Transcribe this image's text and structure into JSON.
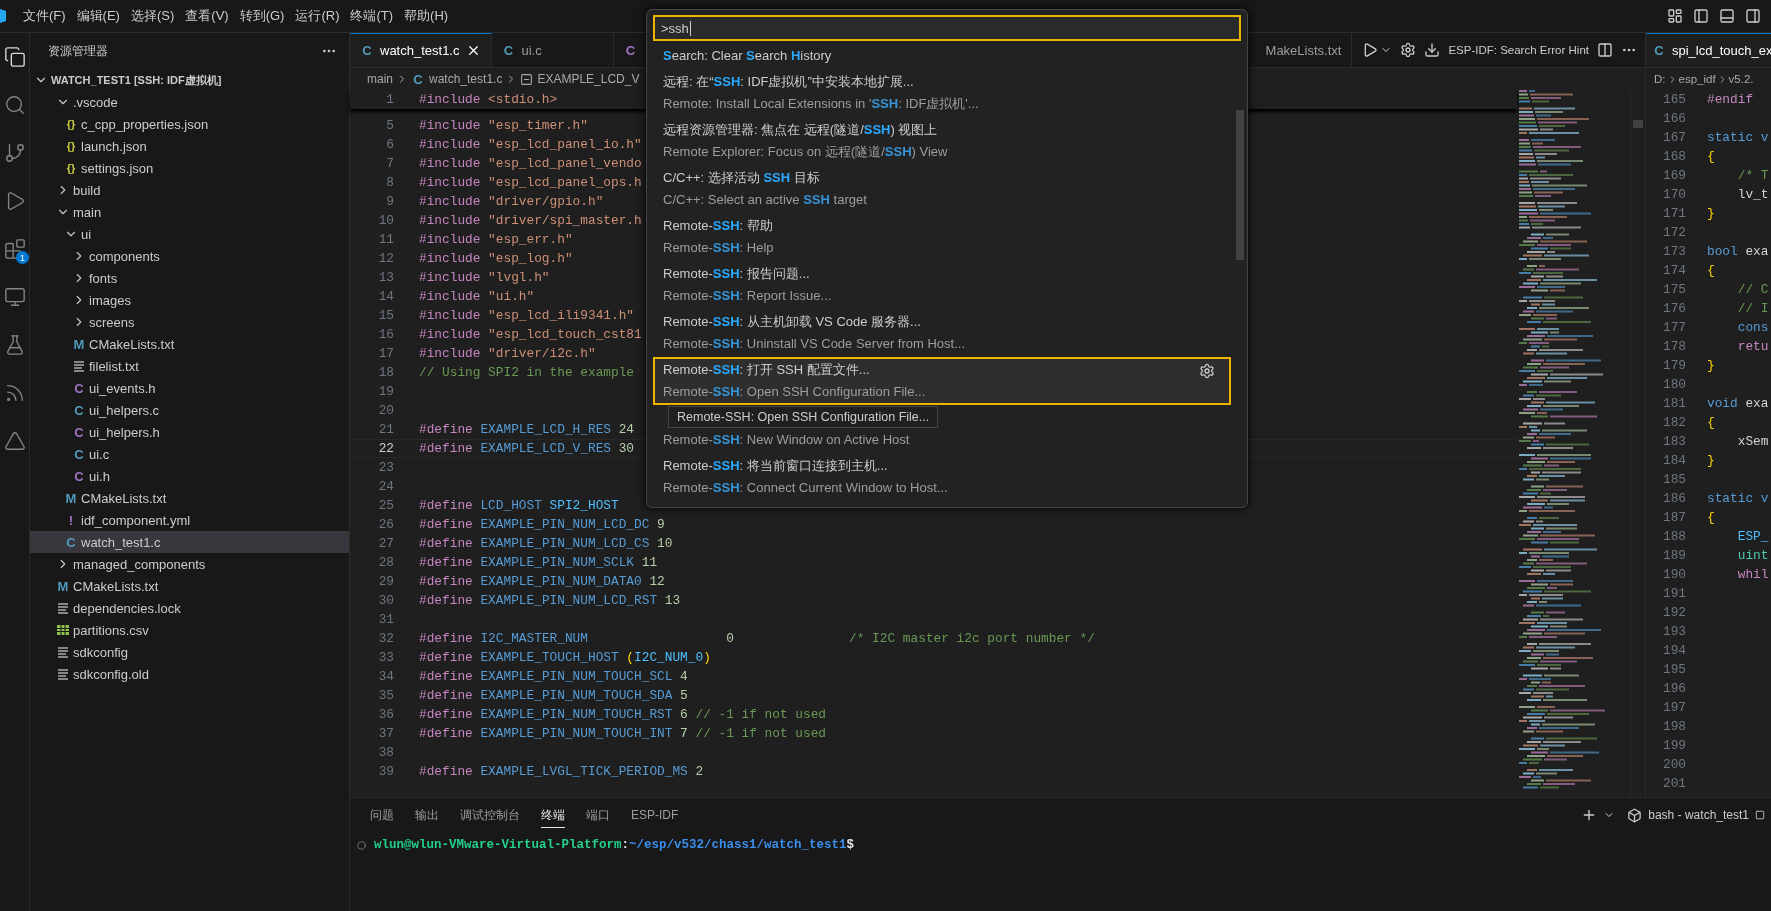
{
  "menubar": {
    "items": [
      "文件(F)",
      "编辑(E)",
      "选择(S)",
      "查看(V)",
      "转到(G)",
      "运行(R)",
      "终端(T)",
      "帮助(H)"
    ]
  },
  "activity_bar": {
    "items": [
      {
        "kind": "explorer",
        "selected": true
      },
      {
        "kind": "search",
        "selected": false
      },
      {
        "kind": "source_control",
        "selected": false
      },
      {
        "kind": "run",
        "selected": false
      },
      {
        "kind": "extensions",
        "selected": false,
        "badge": "1"
      },
      {
        "kind": "remote",
        "selected": false
      },
      {
        "kind": "testing",
        "selected": false
      },
      {
        "kind": "espidf",
        "selected": false
      },
      {
        "kind": "other",
        "selected": false
      }
    ]
  },
  "explorer": {
    "title": "资源管理器",
    "root": {
      "label": "WATCH_TEST1 [SSH: IDF虚拟机]",
      "expanded": true
    },
    "items": [
      {
        "name": ".vscode",
        "kind": "folder",
        "expanded": true,
        "selected": false,
        "children": [
          {
            "name": "c_cpp_properties.json",
            "kind": "json",
            "glyph": "{}",
            "selected": false
          },
          {
            "name": "launch.json",
            "kind": "json",
            "glyph": "{}",
            "selected": false
          },
          {
            "name": "settings.json",
            "kind": "json",
            "glyph": "{}",
            "selected": false
          }
        ]
      },
      {
        "name": "build",
        "kind": "folder",
        "expanded": false,
        "selected": false
      },
      {
        "name": "main",
        "kind": "folder",
        "expanded": true,
        "selected": false,
        "children": [
          {
            "name": "ui",
            "kind": "folder",
            "expanded": true,
            "selected": false,
            "children": [
              {
                "name": "components",
                "kind": "folder",
                "expanded": false,
                "selected": false
              },
              {
                "name": "fonts",
                "kind": "folder",
                "expanded": false,
                "selected": false
              },
              {
                "name": "images",
                "kind": "folder",
                "expanded": false,
                "selected": false
              },
              {
                "name": "screens",
                "kind": "folder",
                "expanded": false,
                "selected": false
              },
              {
                "name": "CMakeLists.txt",
                "kind": "cmake",
                "glyph": "M",
                "selected": false
              },
              {
                "name": "filelist.txt",
                "kind": "text",
                "selected": false
              },
              {
                "name": "ui_events.h",
                "kind": "h",
                "glyph": "C",
                "selected": false
              },
              {
                "name": "ui_helpers.c",
                "kind": "c",
                "glyph": "C",
                "selected": false
              },
              {
                "name": "ui_helpers.h",
                "kind": "h",
                "glyph": "C",
                "selected": false
              },
              {
                "name": "ui.c",
                "kind": "c",
                "glyph": "C",
                "selected": false
              },
              {
                "name": "ui.h",
                "kind": "h",
                "glyph": "C",
                "selected": false
              }
            ]
          },
          {
            "name": "CMakeLists.txt",
            "kind": "cmake",
            "glyph": "M",
            "selected": false
          },
          {
            "name": "idf_component.yml",
            "kind": "yml",
            "glyph": "!",
            "selected": false
          },
          {
            "name": "watch_test1.c",
            "kind": "c",
            "glyph": "C",
            "selected": true
          }
        ]
      },
      {
        "name": "managed_components",
        "kind": "folder",
        "expanded": false,
        "selected": false
      },
      {
        "name": "CMakeLists.txt",
        "kind": "cmake",
        "glyph": "M",
        "selected": false
      },
      {
        "name": "dependencies.lock",
        "kind": "text",
        "selected": false
      },
      {
        "name": "partitions.csv",
        "kind": "csv",
        "selected": false
      },
      {
        "name": "sdkconfig",
        "kind": "text",
        "selected": false
      },
      {
        "name": "sdkconfig.old",
        "kind": "text",
        "selected": false
      }
    ]
  },
  "editor": {
    "tabs": [
      {
        "label": "watch_test1.c",
        "kind": "c",
        "glyph": "C",
        "selected": true
      },
      {
        "label": "ui.c",
        "kind": "c",
        "glyph": "C",
        "selected": false
      },
      {
        "kind": "h",
        "glyph": "C",
        "selected": false
      },
      {
        "label": "MakeLists.txt",
        "selected": false
      }
    ],
    "hint_button": "ESP-IDF: Search Error Hint",
    "breadcrumb": [
      {
        "label": "main",
        "kind": "folder"
      },
      {
        "label": "watch_test1.c",
        "kind": "c",
        "glyph": "C"
      },
      {
        "label": "EXAMPLE_LCD_V",
        "kind": "symbol"
      }
    ],
    "sticky_line": {
      "number": "1",
      "current": false,
      "tokens": [
        {
          "kind": "directive",
          "text": "#include"
        },
        {
          "kind": "string",
          "text": " <stdio.h>"
        }
      ]
    },
    "lines": [
      {
        "number": "5",
        "current": false,
        "tokens": [
          {
            "kind": "directive",
            "text": "#include"
          },
          {
            "kind": "string",
            "text": " \"esp_timer.h\""
          }
        ]
      },
      {
        "number": "6",
        "current": false,
        "tokens": [
          {
            "kind": "directive",
            "text": "#include"
          },
          {
            "kind": "string",
            "text": " \"esp_lcd_panel_io.h\""
          }
        ]
      },
      {
        "number": "7",
        "current": false,
        "tokens": [
          {
            "kind": "directive",
            "text": "#include"
          },
          {
            "kind": "string",
            "text": " \"esp_lcd_panel_vendo"
          }
        ]
      },
      {
        "number": "8",
        "current": false,
        "tokens": [
          {
            "kind": "directive",
            "text": "#include"
          },
          {
            "kind": "string",
            "text": " \"esp_lcd_panel_ops.h"
          }
        ]
      },
      {
        "number": "9",
        "current": false,
        "tokens": [
          {
            "kind": "directive",
            "text": "#include"
          },
          {
            "kind": "string",
            "text": " \"driver/gpio.h\""
          }
        ]
      },
      {
        "number": "10",
        "current": false,
        "tokens": [
          {
            "kind": "directive",
            "text": "#include"
          },
          {
            "kind": "string",
            "text": " \"driver/spi_master.h"
          }
        ]
      },
      {
        "number": "11",
        "current": false,
        "tokens": [
          {
            "kind": "directive",
            "text": "#include"
          },
          {
            "kind": "string",
            "text": " \"esp_err.h\""
          }
        ]
      },
      {
        "number": "12",
        "current": false,
        "tokens": [
          {
            "kind": "directive",
            "text": "#include"
          },
          {
            "kind": "string",
            "text": " \"esp_log.h\""
          }
        ]
      },
      {
        "number": "13",
        "current": false,
        "tokens": [
          {
            "kind": "directive",
            "text": "#include"
          },
          {
            "kind": "string",
            "text": " \"lvgl.h\""
          }
        ]
      },
      {
        "number": "14",
        "current": false,
        "tokens": [
          {
            "kind": "directive",
            "text": "#include"
          },
          {
            "kind": "string",
            "text": " \"ui.h\""
          }
        ]
      },
      {
        "number": "15",
        "current": false,
        "tokens": [
          {
            "kind": "directive",
            "text": "#include"
          },
          {
            "kind": "string",
            "text": " \"esp_lcd_ili9341.h\""
          }
        ]
      },
      {
        "number": "16",
        "current": false,
        "tokens": [
          {
            "kind": "directive",
            "text": "#include"
          },
          {
            "kind": "string",
            "text": " \"esp_lcd_touch_cst81"
          }
        ]
      },
      {
        "number": "17",
        "current": false,
        "tokens": [
          {
            "kind": "directive",
            "text": "#include"
          },
          {
            "kind": "string",
            "text": " \"driver/i2c.h\""
          }
        ]
      },
      {
        "number": "18",
        "current": false,
        "tokens": [
          {
            "kind": "comment",
            "text": "// Using SPI2 in the example"
          }
        ]
      },
      {
        "number": "19",
        "current": false
      },
      {
        "number": "20",
        "current": false
      },
      {
        "number": "21",
        "current": false,
        "tokens": [
          {
            "kind": "directive",
            "text": "#define"
          },
          {
            "kind": "macro",
            "text": " EXAMPLE_LCD_H_RES"
          },
          {
            "kind": "number",
            "text": " 24"
          }
        ]
      },
      {
        "number": "22",
        "current": true,
        "tokens": [
          {
            "kind": "directive",
            "text": "#define"
          },
          {
            "kind": "macro",
            "text": " EXAMPLE_LCD_V_RES"
          },
          {
            "kind": "number",
            "text": " 30"
          }
        ]
      },
      {
        "number": "23",
        "current": false
      },
      {
        "number": "24",
        "current": false
      },
      {
        "number": "25",
        "current": false,
        "tokens": [
          {
            "kind": "directive",
            "text": "#define"
          },
          {
            "kind": "macro",
            "text": " LCD_HOST"
          },
          {
            "kind": "constant",
            "text": " SPI2_HOST"
          }
        ]
      },
      {
        "number": "26",
        "current": false,
        "tokens": [
          {
            "kind": "directive",
            "text": "#define"
          },
          {
            "kind": "macro",
            "text": " EXAMPLE_PIN_NUM_LCD_DC"
          },
          {
            "kind": "number",
            "text": " 9"
          }
        ]
      },
      {
        "number": "27",
        "current": false,
        "tokens": [
          {
            "kind": "directive",
            "text": "#define"
          },
          {
            "kind": "macro",
            "text": " EXAMPLE_PIN_NUM_LCD_CS"
          },
          {
            "kind": "number",
            "text": " 10"
          }
        ]
      },
      {
        "number": "28",
        "current": false,
        "tokens": [
          {
            "kind": "directive",
            "text": "#define"
          },
          {
            "kind": "macro",
            "text": " EXAMPLE_PIN_NUM_SCLK"
          },
          {
            "kind": "number",
            "text": " 11"
          }
        ]
      },
      {
        "number": "29",
        "current": false,
        "tokens": [
          {
            "kind": "directive",
            "text": "#define"
          },
          {
            "kind": "macro",
            "text": " EXAMPLE_PIN_NUM_DATA0"
          },
          {
            "kind": "number",
            "text": " 12"
          }
        ]
      },
      {
        "number": "30",
        "current": false,
        "tokens": [
          {
            "kind": "directive",
            "text": "#define"
          },
          {
            "kind": "macro",
            "text": " EXAMPLE_PIN_NUM_LCD_RST"
          },
          {
            "kind": "number",
            "text": " 13"
          }
        ]
      },
      {
        "number": "31",
        "current": false
      },
      {
        "number": "32",
        "current": false,
        "tokens": [
          {
            "kind": "directive",
            "text": "#define"
          },
          {
            "kind": "macro",
            "text": " I2C_MASTER_NUM"
          },
          {
            "kind": "number",
            "text": "                  0"
          },
          {
            "kind": "comment",
            "text": "               /* I2C master i2c port number */"
          }
        ]
      },
      {
        "number": "33",
        "current": false,
        "tokens": [
          {
            "kind": "directive",
            "text": "#define"
          },
          {
            "kind": "macro",
            "text": " EXAMPLE_TOUCH_HOST"
          },
          {
            "kind": "bracket",
            "text": " ("
          },
          {
            "kind": "constant",
            "text": "I2C_NUM_0"
          },
          {
            "kind": "bracket",
            "text": ")"
          }
        ]
      },
      {
        "number": "34",
        "current": false,
        "tokens": [
          {
            "kind": "directive",
            "text": "#define"
          },
          {
            "kind": "macro",
            "text": " EXAMPLE_PIN_NUM_TOUCH_SCL"
          },
          {
            "kind": "number",
            "text": " 4"
          }
        ]
      },
      {
        "number": "35",
        "current": false,
        "tokens": [
          {
            "kind": "directive",
            "text": "#define"
          },
          {
            "kind": "macro",
            "text": " EXAMPLE_PIN_NUM_TOUCH_SDA"
          },
          {
            "kind": "number",
            "text": " 5"
          }
        ]
      },
      {
        "number": "36",
        "current": false,
        "tokens": [
          {
            "kind": "directive",
            "text": "#define"
          },
          {
            "kind": "macro",
            "text": " EXAMPLE_PIN_NUM_TOUCH_RST"
          },
          {
            "kind": "number",
            "text": " 6"
          },
          {
            "kind": "comment",
            "text": " // -1 if not used"
          }
        ]
      },
      {
        "number": "37",
        "current": false,
        "tokens": [
          {
            "kind": "directive",
            "text": "#define"
          },
          {
            "kind": "macro",
            "text": " EXAMPLE_PIN_NUM_TOUCH_INT"
          },
          {
            "kind": "number",
            "text": " 7"
          },
          {
            "kind": "comment",
            "text": " // -1 if not used"
          }
        ]
      },
      {
        "number": "38",
        "current": false
      },
      {
        "number": "39",
        "current": false,
        "tokens": [
          {
            "kind": "directive",
            "text": "#define"
          },
          {
            "kind": "macro",
            "text": " EXAMPLE_LVGL_TICK_PERIOD_MS"
          },
          {
            "kind": "number",
            "text": " 2"
          }
        ]
      }
    ]
  },
  "secondary_editor": {
    "tab": {
      "label": "spi_lcd_touch_ex",
      "kind": "c",
      "glyph": "C",
      "selected": true
    },
    "breadcrumb": [
      {
        "label": "D:"
      },
      {
        "label": "esp_idf"
      },
      {
        "label": "v5.2."
      }
    ],
    "lines": [
      {
        "number": "165",
        "tokens": [
          {
            "kind": "directive",
            "text": "#endif"
          }
        ]
      },
      {
        "number": "166"
      },
      {
        "number": "167",
        "tokens": [
          {
            "kind": "keyword",
            "text": "static v"
          }
        ]
      },
      {
        "number": "168",
        "tokens": [
          {
            "kind": "bracket",
            "text": "{"
          }
        ]
      },
      {
        "number": "169",
        "tokens": [
          {
            "kind": "comment",
            "text": "    /* T"
          }
        ]
      },
      {
        "number": "170",
        "tokens": [
          {
            "kind": "plain",
            "text": "    lv_t"
          }
        ]
      },
      {
        "number": "171",
        "tokens": [
          {
            "kind": "bracket",
            "text": "}"
          }
        ]
      },
      {
        "number": "172"
      },
      {
        "number": "173",
        "tokens": [
          {
            "kind": "keyword",
            "text": "bool"
          },
          {
            "kind": "plain",
            "text": " exa"
          }
        ]
      },
      {
        "number": "174",
        "tokens": [
          {
            "kind": "bracket",
            "text": "{"
          }
        ]
      },
      {
        "number": "175",
        "tokens": [
          {
            "kind": "comment",
            "text": "    // C"
          }
        ]
      },
      {
        "number": "176",
        "tokens": [
          {
            "kind": "comment",
            "text": "    // I"
          }
        ]
      },
      {
        "number": "177",
        "tokens": [
          {
            "kind": "keyword",
            "text": "    cons"
          }
        ]
      },
      {
        "number": "178",
        "tokens": [
          {
            "kind": "control",
            "text": "    retu"
          }
        ]
      },
      {
        "number": "179",
        "tokens": [
          {
            "kind": "bracket",
            "text": "}"
          }
        ]
      },
      {
        "number": "180"
      },
      {
        "number": "181",
        "tokens": [
          {
            "kind": "keyword",
            "text": "void"
          },
          {
            "kind": "plain",
            "text": " exa"
          }
        ]
      },
      {
        "number": "182",
        "tokens": [
          {
            "kind": "bracket",
            "text": "{"
          }
        ]
      },
      {
        "number": "183",
        "tokens": [
          {
            "kind": "plain",
            "text": "    xSem"
          }
        ]
      },
      {
        "number": "184",
        "tokens": [
          {
            "kind": "bracket",
            "text": "}"
          }
        ]
      },
      {
        "number": "185"
      },
      {
        "number": "186",
        "tokens": [
          {
            "kind": "keyword",
            "text": "static v"
          }
        ]
      },
      {
        "number": "187",
        "tokens": [
          {
            "kind": "bracket",
            "text": "{"
          }
        ]
      },
      {
        "number": "188",
        "tokens": [
          {
            "kind": "constant",
            "text": "    ESP_"
          }
        ]
      },
      {
        "number": "189",
        "tokens": [
          {
            "kind": "type",
            "text": "    uint"
          }
        ]
      },
      {
        "number": "190",
        "tokens": [
          {
            "kind": "control",
            "text": "    whil"
          }
        ]
      },
      {
        "number": "191"
      },
      {
        "number": "192"
      },
      {
        "number": "193"
      },
      {
        "number": "194"
      },
      {
        "number": "195"
      },
      {
        "number": "196"
      },
      {
        "number": "197"
      },
      {
        "number": "198"
      },
      {
        "number": "199"
      },
      {
        "number": "200"
      },
      {
        "number": "201"
      }
    ]
  },
  "command_palette": {
    "query": ">ssh",
    "items": [
      {
        "title": "**S**earch: Clear **S**earch **H**istory",
        "selected": false
      },
      {
        "title": "远程: 在“**SSH**: IDF虚拟机”中安装本地扩展...",
        "subtitle": "Remote: Install Local Extensions in '**SSH**: IDF虚拟机'...",
        "selected": false
      },
      {
        "title": "远程资源管理器: 焦点在 远程(隧道/**SSH**) 视图上",
        "subtitle": "Remote Explorer: Focus on 远程(隧道/**SSH**) View",
        "selected": false
      },
      {
        "title": "C/C++: 选择活动 **SSH** 目标",
        "subtitle": "C/C++: Select an active **SSH** target",
        "selected": false
      },
      {
        "title": "Remote-**SSH**: 帮助",
        "subtitle": "Remote-**SSH**: Help",
        "selected": false
      },
      {
        "title": "Remote-**SSH**: 报告问题...",
        "subtitle": "Remote-**SSH**: Report Issue...",
        "selected": false
      },
      {
        "title": "Remote-**SSH**: 从主机卸载 VS Code 服务器...",
        "subtitle": "Remote-**SSH**: Uninstall VS Code Server from Host...",
        "selected": false
      },
      {
        "title": "Remote-**SSH**: 打开 SSH 配置文件...",
        "subtitle": "Remote-**SSH**: Open SSH Configuration File...",
        "selected": true
      },
      {
        "subtitle": "Remote-**SSH**: New Window on Active Host",
        "selected": false
      },
      {
        "title": "Remote-**SSH**: 将当前窗口连接到主机...",
        "subtitle": "Remote-**SSH**: Connect Current Window to Host...",
        "selected": false
      }
    ],
    "tooltip": "Remote-SSH: Open SSH Configuration File..."
  },
  "panel": {
    "tabs": [
      {
        "label": "问题",
        "selected": false
      },
      {
        "label": "输出",
        "selected": false
      },
      {
        "label": "调试控制台",
        "selected": false
      },
      {
        "label": "终端",
        "selected": true
      },
      {
        "label": "端口",
        "selected": false
      },
      {
        "label": "ESP-IDF",
        "selected": false
      }
    ],
    "terminal_name": "bash - watch_test1",
    "prompt": {
      "user_host": "wlun@wlun-VMware-Virtual-Platform",
      "separator": ":",
      "path": "~/esp/v532/chass1/watch_test1",
      "symbol": "$"
    }
  }
}
